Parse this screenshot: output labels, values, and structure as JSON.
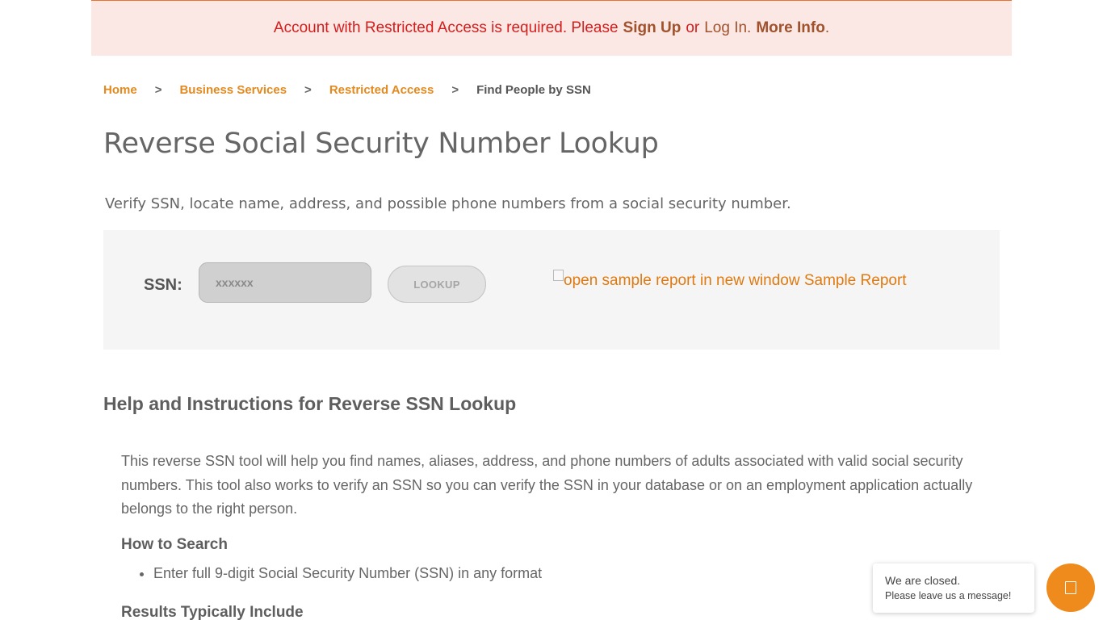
{
  "alert": {
    "text_before": "Account with Restricted Access is required. Please",
    "signup_label": "Sign Up",
    "or_text": "or",
    "login_label": "Log In.",
    "more_info_label": "More Info",
    "period": "."
  },
  "breadcrumb": {
    "items": [
      {
        "label": "Home"
      },
      {
        "label": "Business Services"
      },
      {
        "label": "Restricted Access"
      }
    ],
    "separator": ">",
    "current": "Find People by SSN"
  },
  "header": {
    "title": "Reverse Social Security Number Lookup",
    "subtitle": "Verify SSN, locate name, address, and possible phone numbers from a social security number."
  },
  "search": {
    "label": "SSN:",
    "placeholder": "xxxxxx",
    "button_label": "LOOKUP",
    "sample_link_label": "open sample report in new window Sample Report"
  },
  "help": {
    "heading": "Help and Instructions for Reverse SSN Lookup",
    "description": "This reverse SSN tool will help you find names, aliases, address, and phone numbers of adults associated with valid social security numbers. This tool also works to verify an SSN so you can verify the SSN in your database or on an employment application actually belongs to the right person.",
    "how_heading": "How to Search",
    "how_items": [
      "Enter full 9-digit Social Security Number (SSN) in any format"
    ],
    "results_heading": "Results Typically Include"
  },
  "chat": {
    "status": "We are closed.",
    "message": "Please leave us a message!",
    "icon": "chat-icon"
  },
  "colors": {
    "accent": "#e28a20",
    "alert_bg": "#fbe7e3",
    "alert_text": "#d21e1e",
    "chat_button": "#ef8a1d"
  }
}
